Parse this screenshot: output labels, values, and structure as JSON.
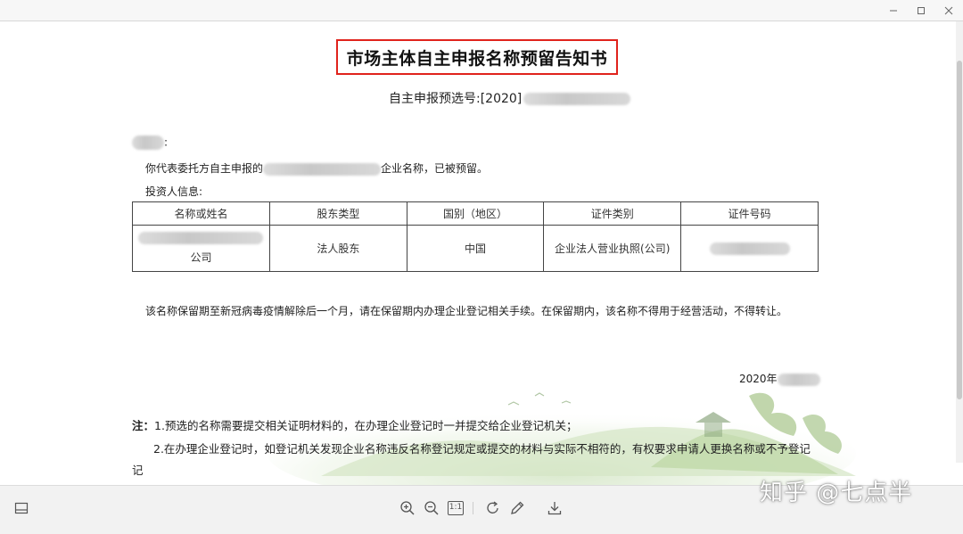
{
  "document": {
    "title": "市场主体自主申报名称预留告知书",
    "prefilling_label": "自主申报预选号:[2020]",
    "salutation_suffix": ":",
    "line1_prefix": "你代表委托方自主申报的",
    "line1_suffix": "企业名称，已被预留。",
    "investor_label": "投资人信息:",
    "table": {
      "headers": [
        "名称或姓名",
        "股东类型",
        "国别（地区）",
        "证件类别",
        "证件号码"
      ],
      "row": {
        "name_suffix": "公司",
        "type": "法人股东",
        "country": "中国",
        "id_type": "企业法人营业执照(公司)"
      }
    },
    "notice": "该名称保留期至新冠病毒疫情解除后一个月，请在保留期内办理企业登记相关手续。在保留期内，该名称不得用于经营活动，不得转让。",
    "date_prefix": "2020年",
    "note_label": "注：",
    "note1": "1.预选的名称需要提交相关证明材料的，在办理企业登记时一并提交给企业登记机关；",
    "note2": "2.在办理企业登记时，如登记机关发现企业名称违反名称登记规定或提交的材料与实际不相符的，有权要求申请人更换名称或不予登记",
    "note2_wrap": "记"
  },
  "toolbar": {
    "icons": [
      "sidebar-toggle-icon",
      "zoom-in-icon",
      "zoom-out-icon",
      "actual-size-icon",
      "rotate-icon",
      "annotate-pen-icon",
      "download-icon"
    ],
    "actual_size_label": "1:1"
  },
  "watermark": "知乎 @七点半",
  "colors": {
    "highlight_border": "#e0231c",
    "toolbar_bg": "#f2f2f2"
  }
}
